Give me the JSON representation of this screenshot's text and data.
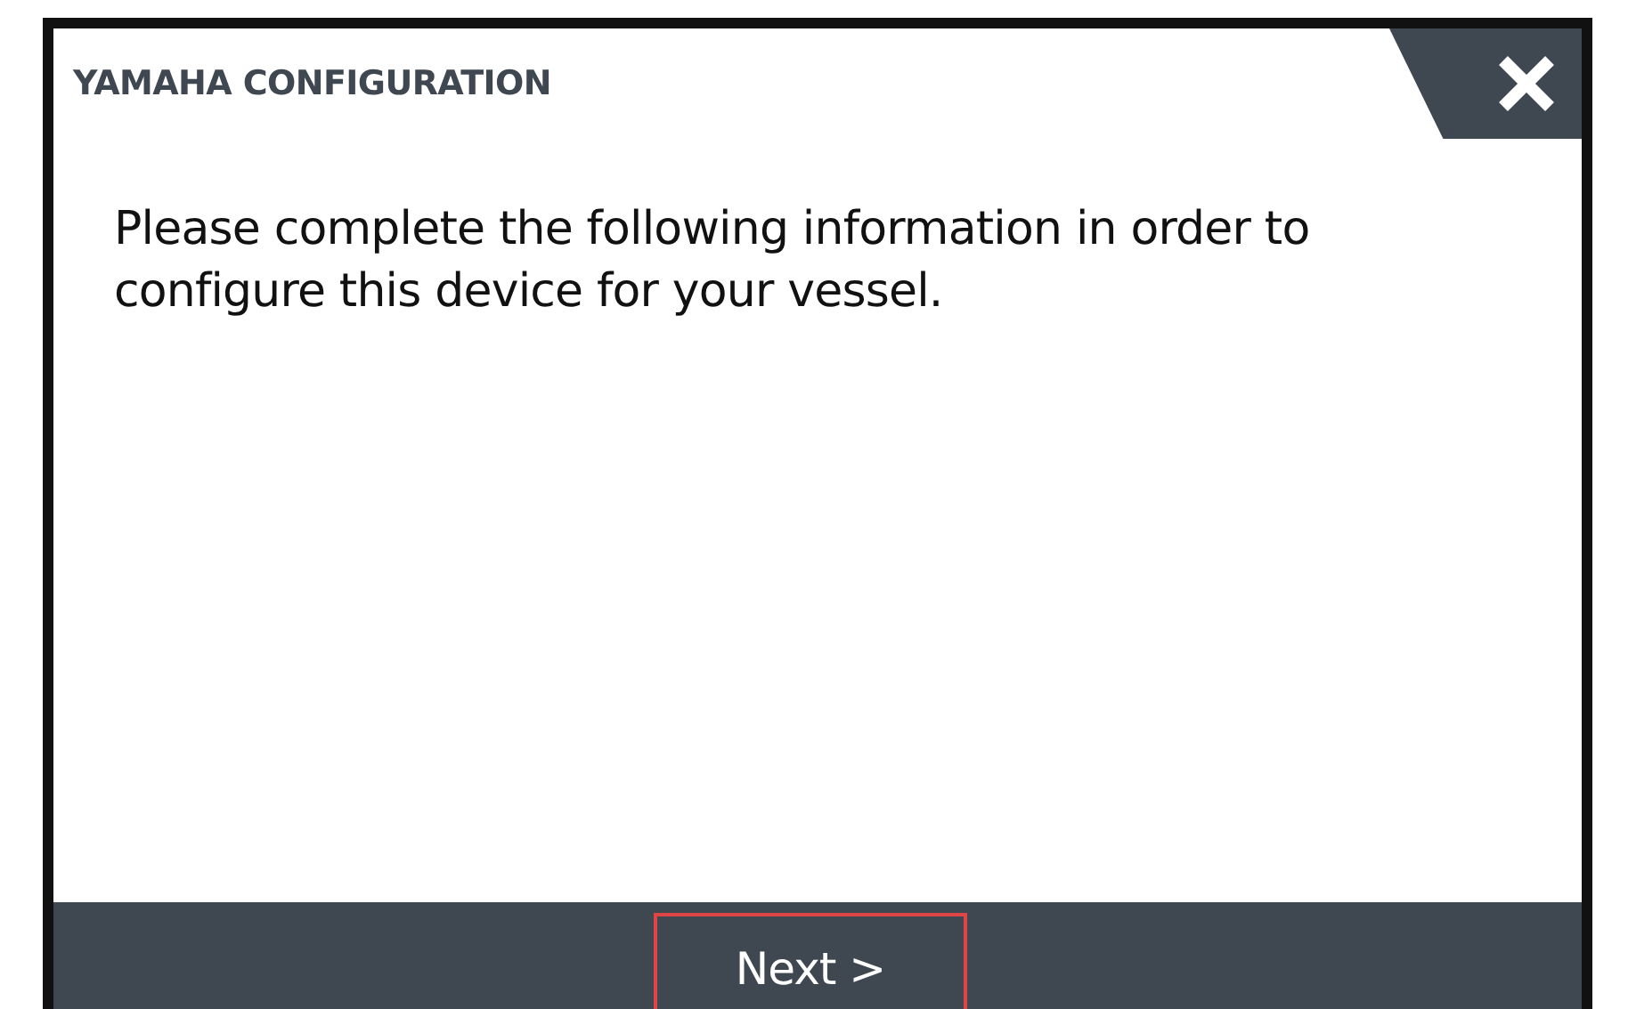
{
  "dialog": {
    "title": "YAMAHA CONFIGURATION",
    "message": "Please complete the following information in order to configure this device for your vessel.",
    "buttons": [
      {
        "label": "Next >",
        "focused": true
      }
    ]
  }
}
